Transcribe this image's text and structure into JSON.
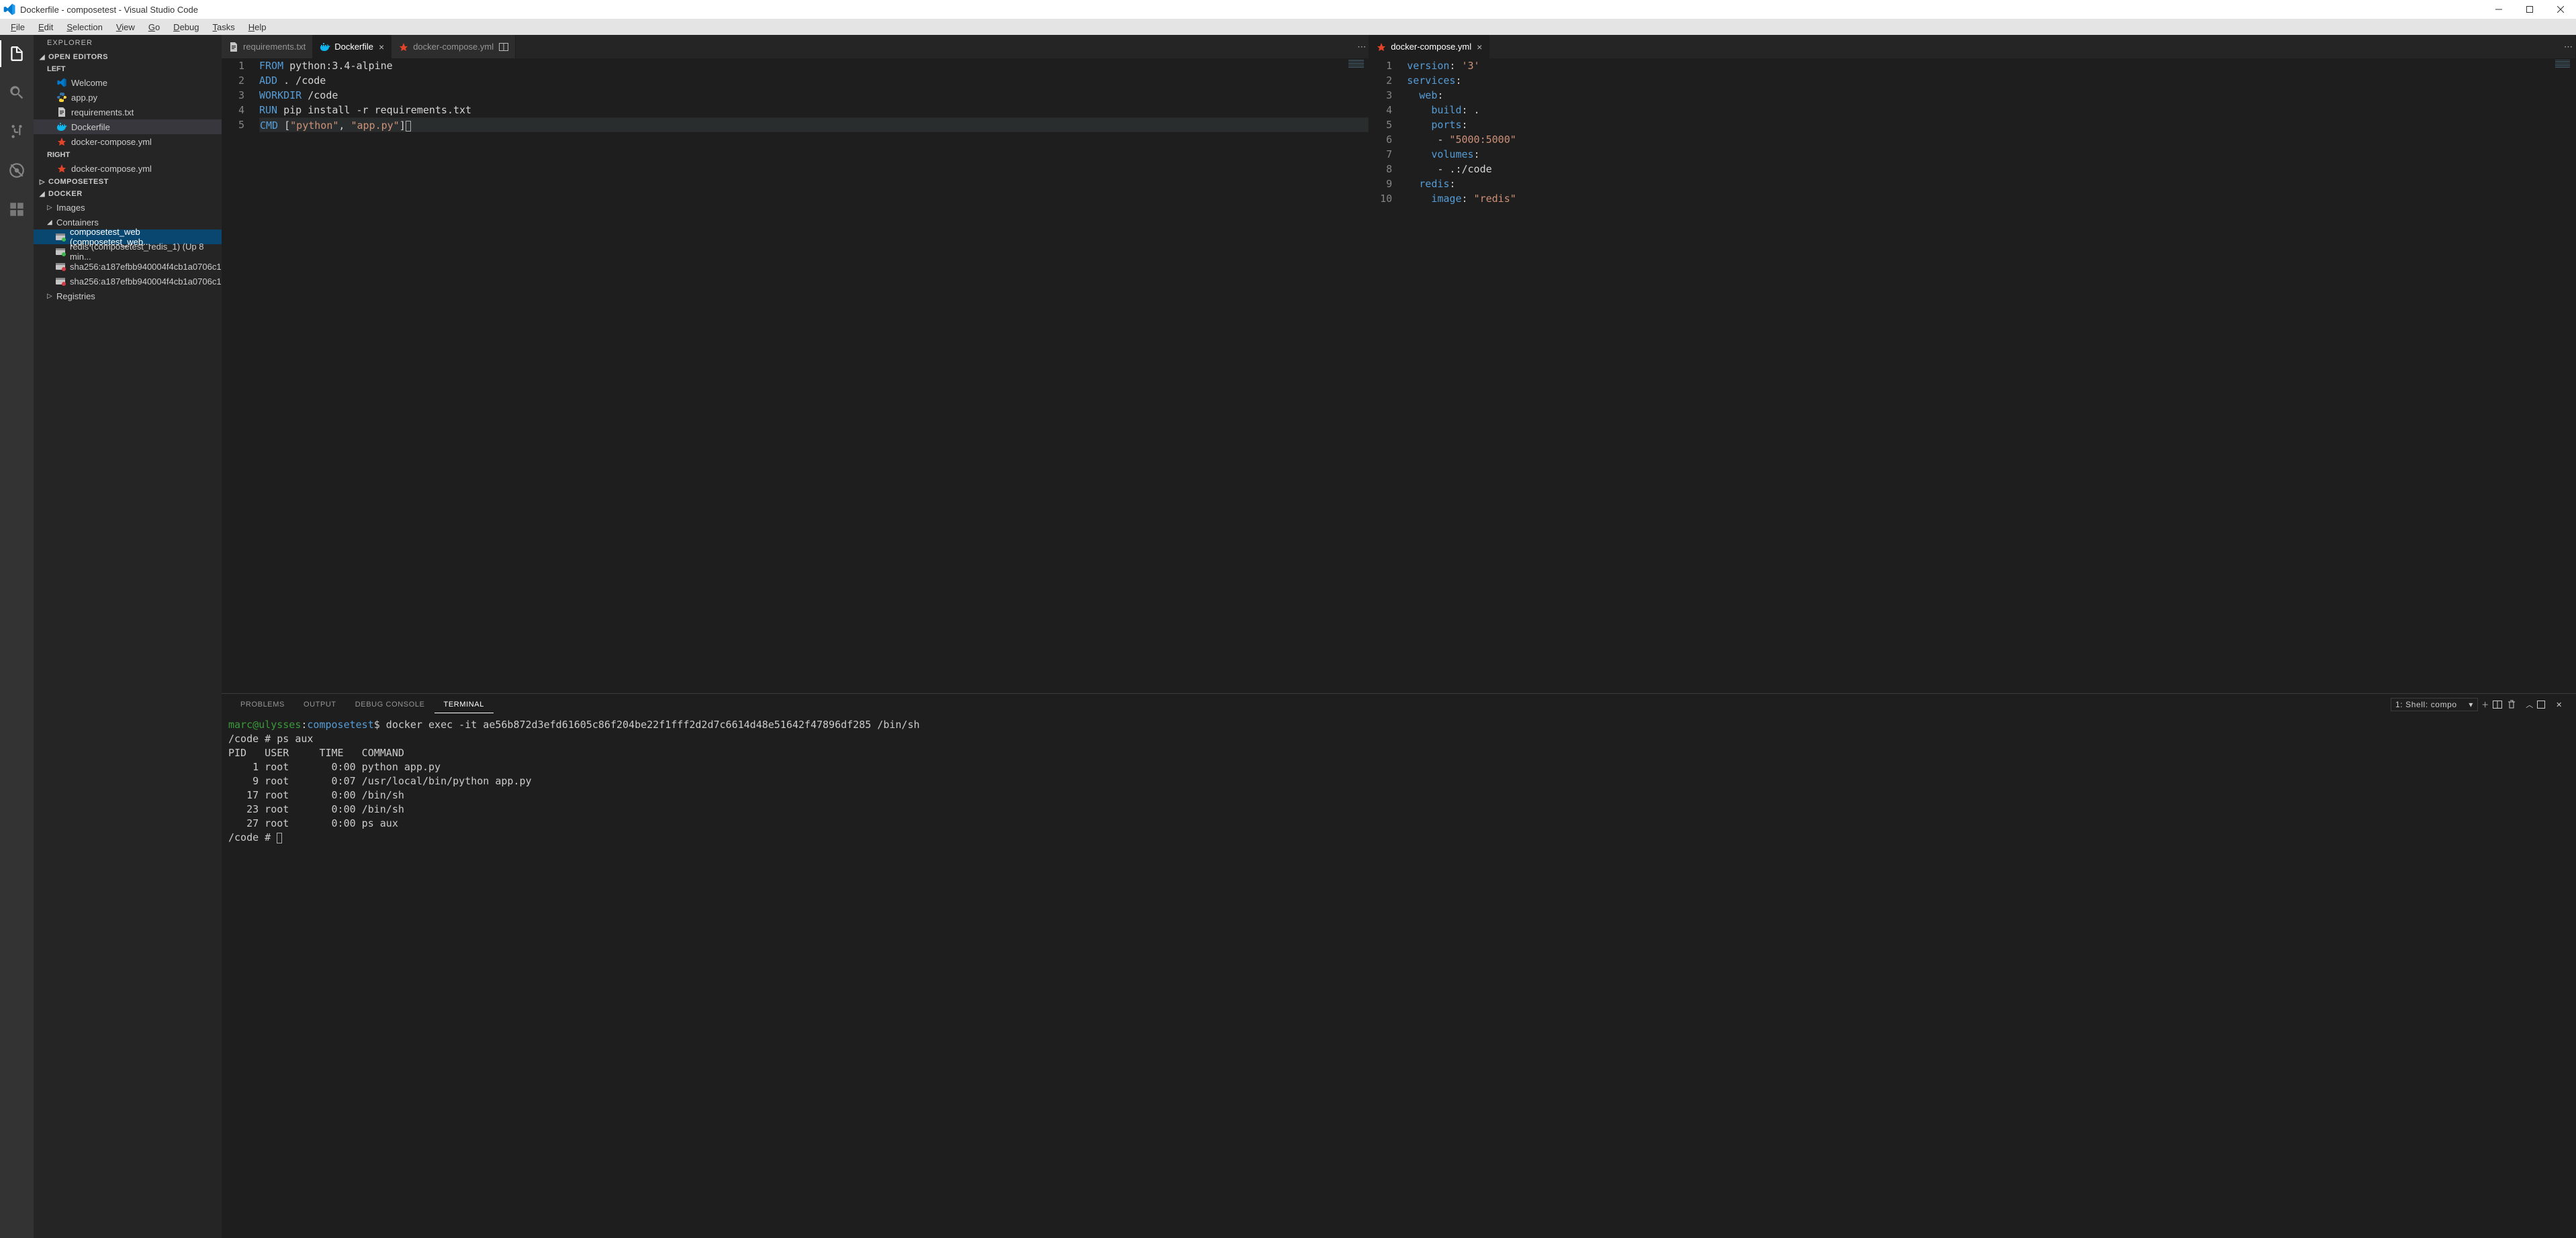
{
  "titlebar": {
    "title": "Dockerfile - composetest - Visual Studio Code"
  },
  "menu": [
    "File",
    "Edit",
    "Selection",
    "View",
    "Go",
    "Debug",
    "Tasks",
    "Help"
  ],
  "sidebar": {
    "title": "EXPLORER",
    "openEditors": {
      "header": "OPEN EDITORS",
      "groups": [
        {
          "label": "LEFT",
          "items": [
            {
              "icon": "vscode",
              "label": "Welcome"
            },
            {
              "icon": "py",
              "label": "app.py"
            },
            {
              "icon": "txt",
              "label": "requirements.txt"
            },
            {
              "icon": "docker",
              "label": "Dockerfile",
              "active": true
            },
            {
              "icon": "compose",
              "label": "docker-compose.yml"
            }
          ]
        },
        {
          "label": "RIGHT",
          "items": [
            {
              "icon": "compose",
              "label": "docker-compose.yml"
            }
          ]
        }
      ]
    },
    "folder": {
      "header": "COMPOSETEST"
    },
    "docker": {
      "header": "DOCKER",
      "nodes": [
        {
          "type": "parent",
          "label": "Images",
          "expanded": false
        },
        {
          "type": "parent",
          "label": "Containers",
          "expanded": true
        },
        {
          "type": "container",
          "status": "running",
          "label": "composetest_web (composetest_web...",
          "selected": true
        },
        {
          "type": "container",
          "status": "running",
          "label": "redis (composetest_redis_1) (Up 8 min..."
        },
        {
          "type": "container",
          "status": "stopped",
          "label": "sha256:a187efbb940004f4cb1a0706c1..."
        },
        {
          "type": "container",
          "status": "stopped",
          "label": "sha256:a187efbb940004f4cb1a0706c1..."
        },
        {
          "type": "parent",
          "label": "Registries",
          "expanded": false
        }
      ]
    }
  },
  "editorLeft": {
    "tabs": [
      {
        "icon": "txt",
        "label": "requirements.txt"
      },
      {
        "icon": "docker",
        "label": "Dockerfile",
        "active": true,
        "close": true
      },
      {
        "icon": "compose",
        "label": "docker-compose.yml",
        "split": true
      }
    ],
    "lines": [
      [
        {
          "c": "tok-kw",
          "t": "FROM"
        },
        {
          "c": "tok-plain",
          "t": " python:3.4-alpine"
        }
      ],
      [
        {
          "c": "tok-kw",
          "t": "ADD"
        },
        {
          "c": "tok-plain",
          "t": " . /code"
        }
      ],
      [
        {
          "c": "tok-kw",
          "t": "WORKDIR"
        },
        {
          "c": "tok-plain",
          "t": " /code"
        }
      ],
      [
        {
          "c": "tok-kw",
          "t": "RUN"
        },
        {
          "c": "tok-plain",
          "t": " pip install -r requirements.txt"
        }
      ],
      [
        {
          "c": "tok-kw",
          "t": "CMD"
        },
        {
          "c": "tok-plain",
          "t": " ["
        },
        {
          "c": "tok-str",
          "t": "\"python\""
        },
        {
          "c": "tok-plain",
          "t": ", "
        },
        {
          "c": "tok-str",
          "t": "\"app.py\""
        },
        {
          "c": "tok-plain",
          "t": "]"
        }
      ]
    ],
    "activeLine": 5
  },
  "editorRight": {
    "tabs": [
      {
        "icon": "compose",
        "label": "docker-compose.yml",
        "active": true,
        "close": true
      }
    ],
    "lines": [
      [
        {
          "c": "tok-key",
          "t": "version"
        },
        {
          "c": "tok-plain",
          "t": ": "
        },
        {
          "c": "tok-val",
          "t": "'3'"
        }
      ],
      [
        {
          "c": "tok-key",
          "t": "services"
        },
        {
          "c": "tok-plain",
          "t": ":"
        }
      ],
      [
        {
          "c": "tok-plain",
          "t": "  "
        },
        {
          "c": "tok-key",
          "t": "web"
        },
        {
          "c": "tok-plain",
          "t": ":"
        }
      ],
      [
        {
          "c": "tok-plain",
          "t": "    "
        },
        {
          "c": "tok-key",
          "t": "build"
        },
        {
          "c": "tok-plain",
          "t": ": ."
        }
      ],
      [
        {
          "c": "tok-plain",
          "t": "    "
        },
        {
          "c": "tok-key",
          "t": "ports"
        },
        {
          "c": "tok-plain",
          "t": ":"
        }
      ],
      [
        {
          "c": "tok-plain",
          "t": "     - "
        },
        {
          "c": "tok-val",
          "t": "\"5000:5000\""
        }
      ],
      [
        {
          "c": "tok-plain",
          "t": "    "
        },
        {
          "c": "tok-key",
          "t": "volumes"
        },
        {
          "c": "tok-plain",
          "t": ":"
        }
      ],
      [
        {
          "c": "tok-plain",
          "t": "     - .:/code"
        }
      ],
      [
        {
          "c": "tok-plain",
          "t": "  "
        },
        {
          "c": "tok-key",
          "t": "redis"
        },
        {
          "c": "tok-plain",
          "t": ":"
        }
      ],
      [
        {
          "c": "tok-plain",
          "t": "    "
        },
        {
          "c": "tok-key",
          "t": "image"
        },
        {
          "c": "tok-plain",
          "t": ": "
        },
        {
          "c": "tok-val",
          "t": "\"redis\""
        }
      ]
    ]
  },
  "panel": {
    "tabs": [
      "PROBLEMS",
      "OUTPUT",
      "DEBUG CONSOLE",
      "TERMINAL"
    ],
    "activeTab": "TERMINAL",
    "selector": "1: Shell: compo",
    "terminal": {
      "user": "marc",
      "host": "ulysses",
      "path": "composetest",
      "sep": ":",
      "suffix": "$",
      "cmd": " docker exec -it ae56b872d3efd61605c86f204be22f1fff2d2d7c6614d48e51642f47896df285 /bin/sh",
      "lines": [
        "/code # ps aux",
        "PID   USER     TIME   COMMAND",
        "    1 root       0:00 python app.py",
        "    9 root       0:07 /usr/local/bin/python app.py",
        "   17 root       0:00 /bin/sh",
        "   23 root       0:00 /bin/sh",
        "   27 root       0:00 ps aux",
        "/code # "
      ]
    }
  }
}
